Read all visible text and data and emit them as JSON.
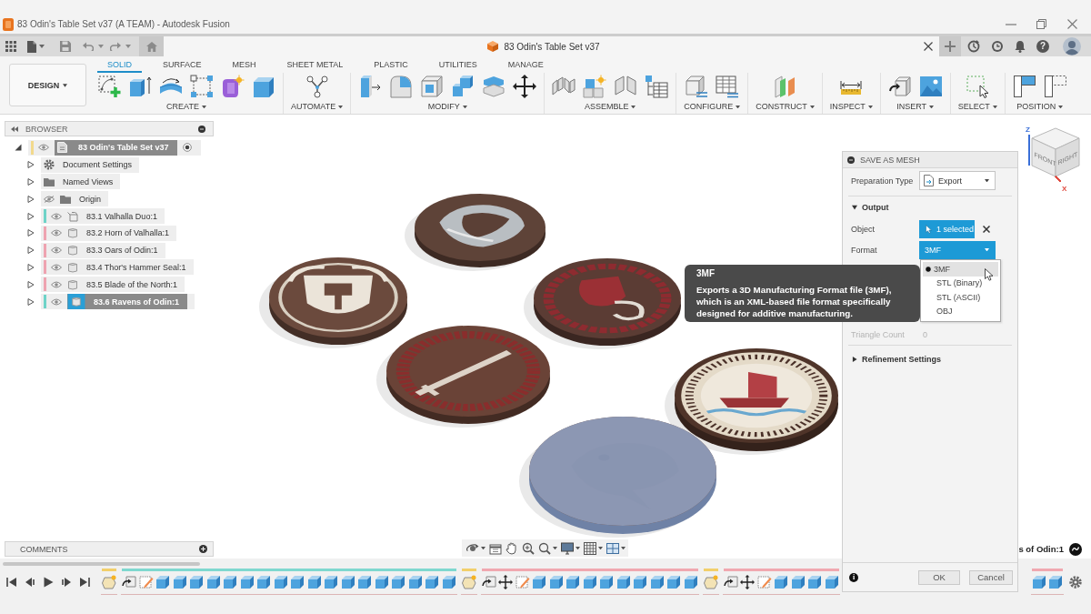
{
  "window": {
    "title": "83 Odin's Table Set v37 (A TEAM) - Autodesk Fusion"
  },
  "document_tab": {
    "title": "83 Odin's Table Set v37"
  },
  "help_button": {
    "label": "?"
  },
  "workspace": {
    "label": "DESIGN"
  },
  "ribbon": {
    "tabs": [
      {
        "label": "SOLID",
        "selected": true
      },
      {
        "label": "SURFACE",
        "selected": false
      },
      {
        "label": "MESH",
        "selected": false
      },
      {
        "label": "SHEET METAL",
        "selected": false
      },
      {
        "label": "PLASTIC",
        "selected": false
      },
      {
        "label": "UTILITIES",
        "selected": false
      },
      {
        "label": "MANAGE",
        "selected": false
      }
    ],
    "groups": [
      {
        "label": "CREATE"
      },
      {
        "label": "AUTOMATE"
      },
      {
        "label": "MODIFY"
      },
      {
        "label": "ASSEMBLE"
      },
      {
        "label": "CONFIGURE"
      },
      {
        "label": "CONSTRUCT"
      },
      {
        "label": "INSPECT"
      },
      {
        "label": "INSERT"
      },
      {
        "label": "SELECT"
      },
      {
        "label": "POSITION"
      }
    ]
  },
  "browser": {
    "title": "BROWSER",
    "root": {
      "label": "83 Odin's Table Set v37",
      "color": "#f2d98c",
      "visible": true,
      "expanded": true,
      "active": true,
      "children": [
        {
          "kind": "settings",
          "label": "Document Settings",
          "expanded": false,
          "selected": false
        },
        {
          "kind": "folder",
          "label": "Named Views",
          "expanded": false,
          "selected": false
        },
        {
          "kind": "folder",
          "label": "Origin",
          "visible": false,
          "expanded": false,
          "selected": false
        },
        {
          "kind": "assembly",
          "label": "83.1 Valhalla Duo:1",
          "color": "#6fd3c8",
          "visible": true,
          "expanded": false,
          "selected": false
        },
        {
          "kind": "component",
          "label": "83.2 Horn of Valhalla:1",
          "color": "#eea3b0",
          "visible": true,
          "expanded": false,
          "selected": false
        },
        {
          "kind": "component",
          "label": "83.3 Oars of Odin:1",
          "color": "#eea3b0",
          "visible": true,
          "expanded": false,
          "selected": false
        },
        {
          "kind": "component",
          "label": "83.4 Thor's Hammer Seal:1",
          "color": "#eea3b0",
          "visible": true,
          "expanded": false,
          "selected": false
        },
        {
          "kind": "component",
          "label": "83.5 Blade of the North:1",
          "color": "#eea3b0",
          "visible": true,
          "expanded": false,
          "selected": false
        },
        {
          "kind": "component",
          "label": "83.6 Ravens of Odin:1",
          "color": "#6fd3c8",
          "visible": true,
          "expanded": false,
          "selected": true
        }
      ]
    }
  },
  "viewport": {
    "bodies": [
      {
        "selected": false
      },
      {
        "selected": false
      },
      {
        "selected": false
      },
      {
        "selected": false
      },
      {
        "selected": false
      },
      {
        "selected": true
      }
    ],
    "view_cube": {
      "faces": [
        "FRONT",
        "RIGHT"
      ],
      "axes": [
        {
          "label": "Z",
          "color": "#3a6fd8"
        },
        {
          "label": "X",
          "color": "#e04a3f"
        }
      ]
    },
    "selection_label": "s of Odin:1"
  },
  "comments": {
    "title": "COMMENTS"
  },
  "timeline": {
    "groups": [
      {
        "color": "#f2cf6b",
        "features": [
          {
            "kind": "sketch"
          }
        ]
      },
      {
        "color": "#7fd8cf",
        "features": [
          {
            "kind": "insert"
          },
          {
            "kind": "edit"
          },
          {
            "kind": "body"
          },
          {
            "kind": "body"
          },
          {
            "kind": "body"
          },
          {
            "kind": "body"
          },
          {
            "kind": "body"
          },
          {
            "kind": "body"
          },
          {
            "kind": "body"
          },
          {
            "kind": "body"
          },
          {
            "kind": "body"
          },
          {
            "kind": "body"
          },
          {
            "kind": "body"
          },
          {
            "kind": "body"
          },
          {
            "kind": "body"
          },
          {
            "kind": "body"
          },
          {
            "kind": "body"
          },
          {
            "kind": "body"
          },
          {
            "kind": "body"
          },
          {
            "kind": "body"
          }
        ]
      },
      {
        "color": "#f2cf6b",
        "features": [
          {
            "kind": "sketch"
          }
        ]
      },
      {
        "color": "#f0a8b0",
        "features": [
          {
            "kind": "insert"
          },
          {
            "kind": "move"
          },
          {
            "kind": "edit"
          },
          {
            "kind": "body"
          },
          {
            "kind": "body"
          },
          {
            "kind": "body"
          },
          {
            "kind": "body"
          },
          {
            "kind": "body"
          },
          {
            "kind": "body"
          },
          {
            "kind": "body"
          },
          {
            "kind": "body"
          },
          {
            "kind": "body"
          },
          {
            "kind": "body"
          }
        ]
      },
      {
        "color": "#f2cf6b",
        "features": [
          {
            "kind": "sketch"
          }
        ]
      },
      {
        "color": "#f0a8b0",
        "features": [
          {
            "kind": "insert"
          },
          {
            "kind": "move"
          },
          {
            "kind": "edit"
          },
          {
            "kind": "body"
          },
          {
            "kind": "body"
          },
          {
            "kind": "body"
          },
          {
            "kind": "body"
          }
        ]
      },
      {
        "color": "#f0a8b0",
        "features": [
          {
            "kind": "body"
          },
          {
            "kind": "body"
          }
        ]
      }
    ]
  },
  "dialog": {
    "title": "SAVE AS MESH",
    "preparation_type": {
      "label": "Preparation Type",
      "value": "Export"
    },
    "output": {
      "title": "Output",
      "expanded": true
    },
    "object": {
      "label": "Object",
      "value": "1 selected"
    },
    "format": {
      "label": "Format",
      "value": "3MF",
      "open": true,
      "options": [
        {
          "label": "3MF",
          "selected": true
        },
        {
          "label": "STL (Binary)",
          "selected": false
        },
        {
          "label": "STL (ASCII)",
          "selected": false
        },
        {
          "label": "OBJ",
          "selected": false
        }
      ]
    },
    "triangle_count": {
      "label": "Triangle Count",
      "value": "0",
      "disabled": true
    },
    "refinement": {
      "title": "Refinement Settings",
      "expanded": false
    },
    "info_label": "i",
    "buttons": [
      {
        "label": "OK"
      },
      {
        "label": "Cancel"
      }
    ]
  },
  "tooltip": {
    "title": "3MF",
    "text": "Exports a 3D Manufacturing Format file (3MF), which is an XML-based file format specifically designed for additive manufacturing."
  }
}
